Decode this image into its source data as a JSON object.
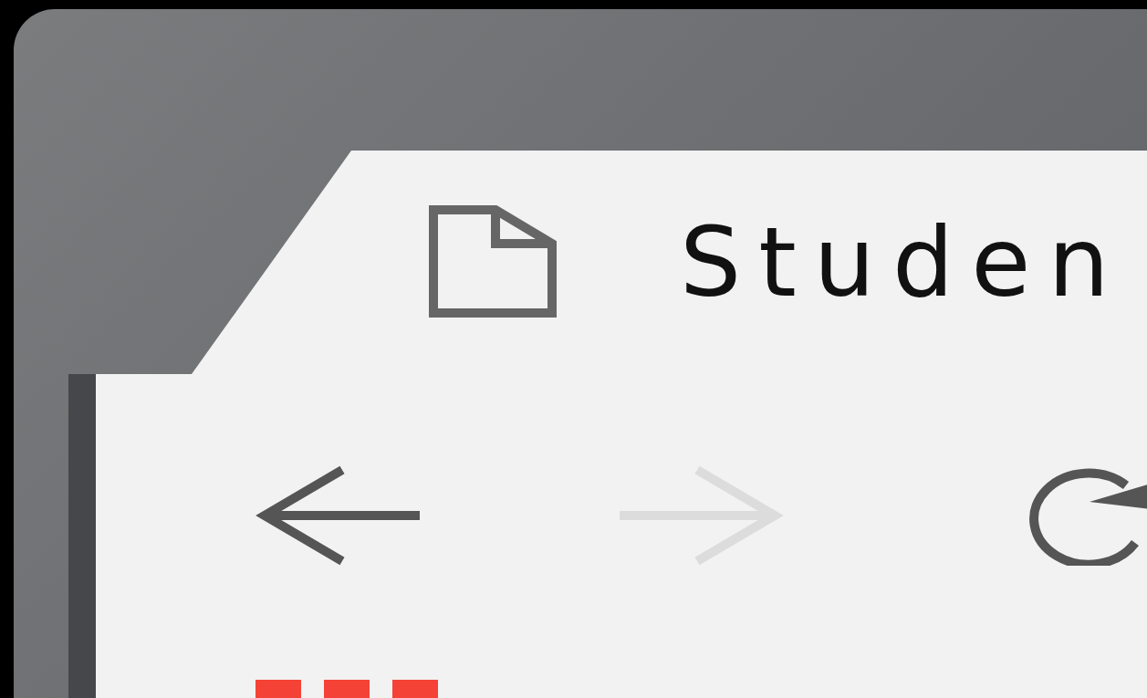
{
  "tab": {
    "title": "Studen"
  },
  "toolbar": {
    "buttons": [
      {
        "kind": "back",
        "disabled": false
      },
      {
        "kind": "forward",
        "disabled": true
      },
      {
        "kind": "reload",
        "disabled": false
      }
    ]
  }
}
